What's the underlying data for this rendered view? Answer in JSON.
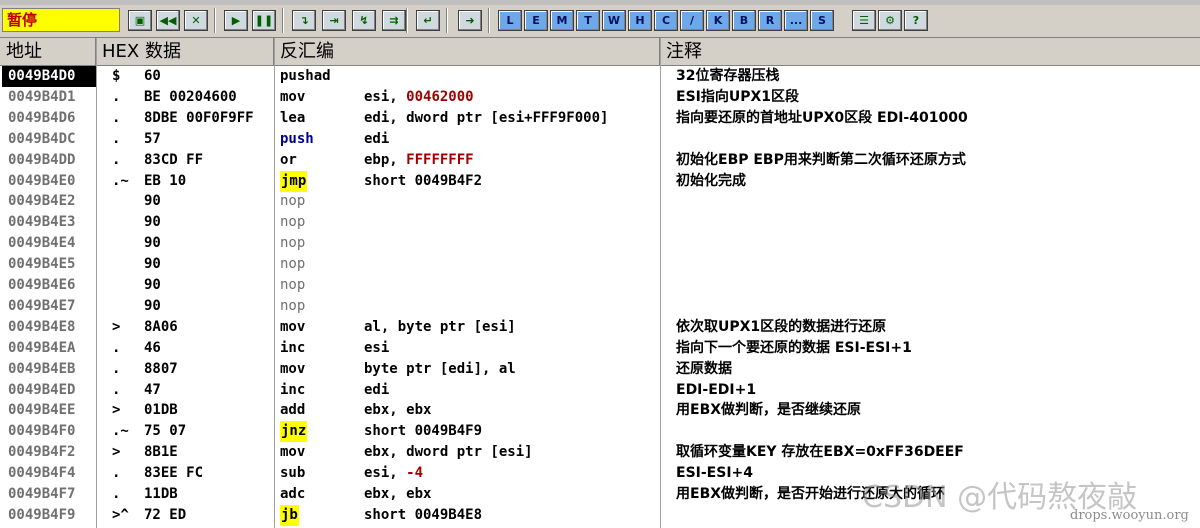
{
  "toolbar": {
    "status": "暂停",
    "icon_buttons": [
      "open",
      "rewind",
      "close",
      "play",
      "pause",
      "step-into",
      "step-over",
      "trace-into",
      "trace-over",
      "execute-till-return",
      "go-to"
    ],
    "letter_buttons": [
      "L",
      "E",
      "M",
      "T",
      "W",
      "H",
      "C",
      "/",
      "K",
      "B",
      "R",
      "...",
      "S"
    ],
    "tail_buttons": [
      "list",
      "options",
      "help"
    ]
  },
  "columns": {
    "address": "地址",
    "hex": "HEX 数据",
    "disasm": "反汇编",
    "comment": "注释"
  },
  "rows": [
    {
      "addr": "0049B4D0",
      "mark": "$",
      "hex": "60",
      "mnemonic": "pushad",
      "operand": "",
      "comment": "32位寄存器压栈",
      "selected": true
    },
    {
      "addr": "0049B4D1",
      "mark": ".",
      "hex": "BE 00204600",
      "mnemonic": "mov",
      "operand": "esi, ",
      "operand_num": "00462000",
      "comment": "ESI指向UPX1区段"
    },
    {
      "addr": "0049B4D6",
      "mark": ".",
      "hex": "8DBE 00F0F9FF",
      "mnemonic": "lea",
      "operand": "edi, dword ptr [esi+FFF9F000]",
      "comment": "指向要还原的首地址UPX0区段 EDI-401000"
    },
    {
      "addr": "0049B4DC",
      "mark": ".",
      "hex": "57",
      "mnemonic": "push",
      "mn_class": "call",
      "operand": "edi",
      "comment": ""
    },
    {
      "addr": "0049B4DD",
      "mark": ".",
      "hex": "83CD FF",
      "mnemonic": "or",
      "operand": "ebp, ",
      "operand_num": "FFFFFFFF",
      "comment": "初始化EBP EBP用来判断第二次循环还原方式"
    },
    {
      "addr": "0049B4E0",
      "mark": ".~",
      "hex": "EB 10",
      "mnemonic": "jmp",
      "mn_class": "jmp",
      "operand": "short 0049B4F2",
      "comment": "初始化完成"
    },
    {
      "addr": "0049B4E2",
      "mark": "",
      "hex": "90",
      "mnemonic": "nop",
      "mn_class": "nop",
      "operand": "",
      "comment": ""
    },
    {
      "addr": "0049B4E3",
      "mark": "",
      "hex": "90",
      "mnemonic": "nop",
      "mn_class": "nop",
      "operand": "",
      "comment": ""
    },
    {
      "addr": "0049B4E4",
      "mark": "",
      "hex": "90",
      "mnemonic": "nop",
      "mn_class": "nop",
      "operand": "",
      "comment": ""
    },
    {
      "addr": "0049B4E5",
      "mark": "",
      "hex": "90",
      "mnemonic": "nop",
      "mn_class": "nop",
      "operand": "",
      "comment": ""
    },
    {
      "addr": "0049B4E6",
      "mark": "",
      "hex": "90",
      "mnemonic": "nop",
      "mn_class": "nop",
      "operand": "",
      "comment": ""
    },
    {
      "addr": "0049B4E7",
      "mark": "",
      "hex": "90",
      "mnemonic": "nop",
      "mn_class": "nop",
      "operand": "",
      "comment": ""
    },
    {
      "addr": "0049B4E8",
      "mark": ">",
      "hex": "8A06",
      "mnemonic": "mov",
      "operand": "al, byte ptr [esi]",
      "comment": "依次取UPX1区段的数据进行还原"
    },
    {
      "addr": "0049B4EA",
      "mark": ".",
      "hex": "46",
      "mnemonic": "inc",
      "operand": "esi",
      "comment": "指向下一个要还原的数据 ESI-ESI+1"
    },
    {
      "addr": "0049B4EB",
      "mark": ".",
      "hex": "8807",
      "mnemonic": "mov",
      "operand": "byte ptr [edi], al",
      "comment": "还原数据"
    },
    {
      "addr": "0049B4ED",
      "mark": ".",
      "hex": "47",
      "mnemonic": "inc",
      "operand": "edi",
      "comment": "EDI-EDI+1"
    },
    {
      "addr": "0049B4EE",
      "mark": ">",
      "hex": "01DB",
      "mnemonic": "add",
      "operand": "ebx, ebx",
      "comment": "用EBX做判断，是否继续还原"
    },
    {
      "addr": "0049B4F0",
      "mark": ".~",
      "hex": "75 07",
      "mnemonic": "jnz",
      "mn_class": "jmp",
      "operand": "short 0049B4F9",
      "comment": ""
    },
    {
      "addr": "0049B4F2",
      "mark": ">",
      "hex": "8B1E",
      "mnemonic": "mov",
      "operand": "ebx, dword ptr [esi]",
      "comment": "取循环变量KEY 存放在EBX=0xFF36DEEF"
    },
    {
      "addr": "0049B4F4",
      "mark": ".",
      "hex": "83EE FC",
      "mnemonic": "sub",
      "operand": "esi, ",
      "operand_num": "-4",
      "comment": "ESI-ESI+4"
    },
    {
      "addr": "0049B4F7",
      "mark": ".",
      "hex": "11DB",
      "mnemonic": "adc",
      "operand": "ebx, ebx",
      "comment": "用EBX做判断，是否开始进行还原大的循环"
    },
    {
      "addr": "0049B4F9",
      "mark": ">^",
      "hex": "72 ED",
      "mnemonic": "jb",
      "mn_class": "jmp",
      "operand": "short 0049B4E8",
      "comment": ""
    }
  ],
  "watermark": "CSDN @代码熬夜敲",
  "watermark_site": "drops.wooyun.org"
}
